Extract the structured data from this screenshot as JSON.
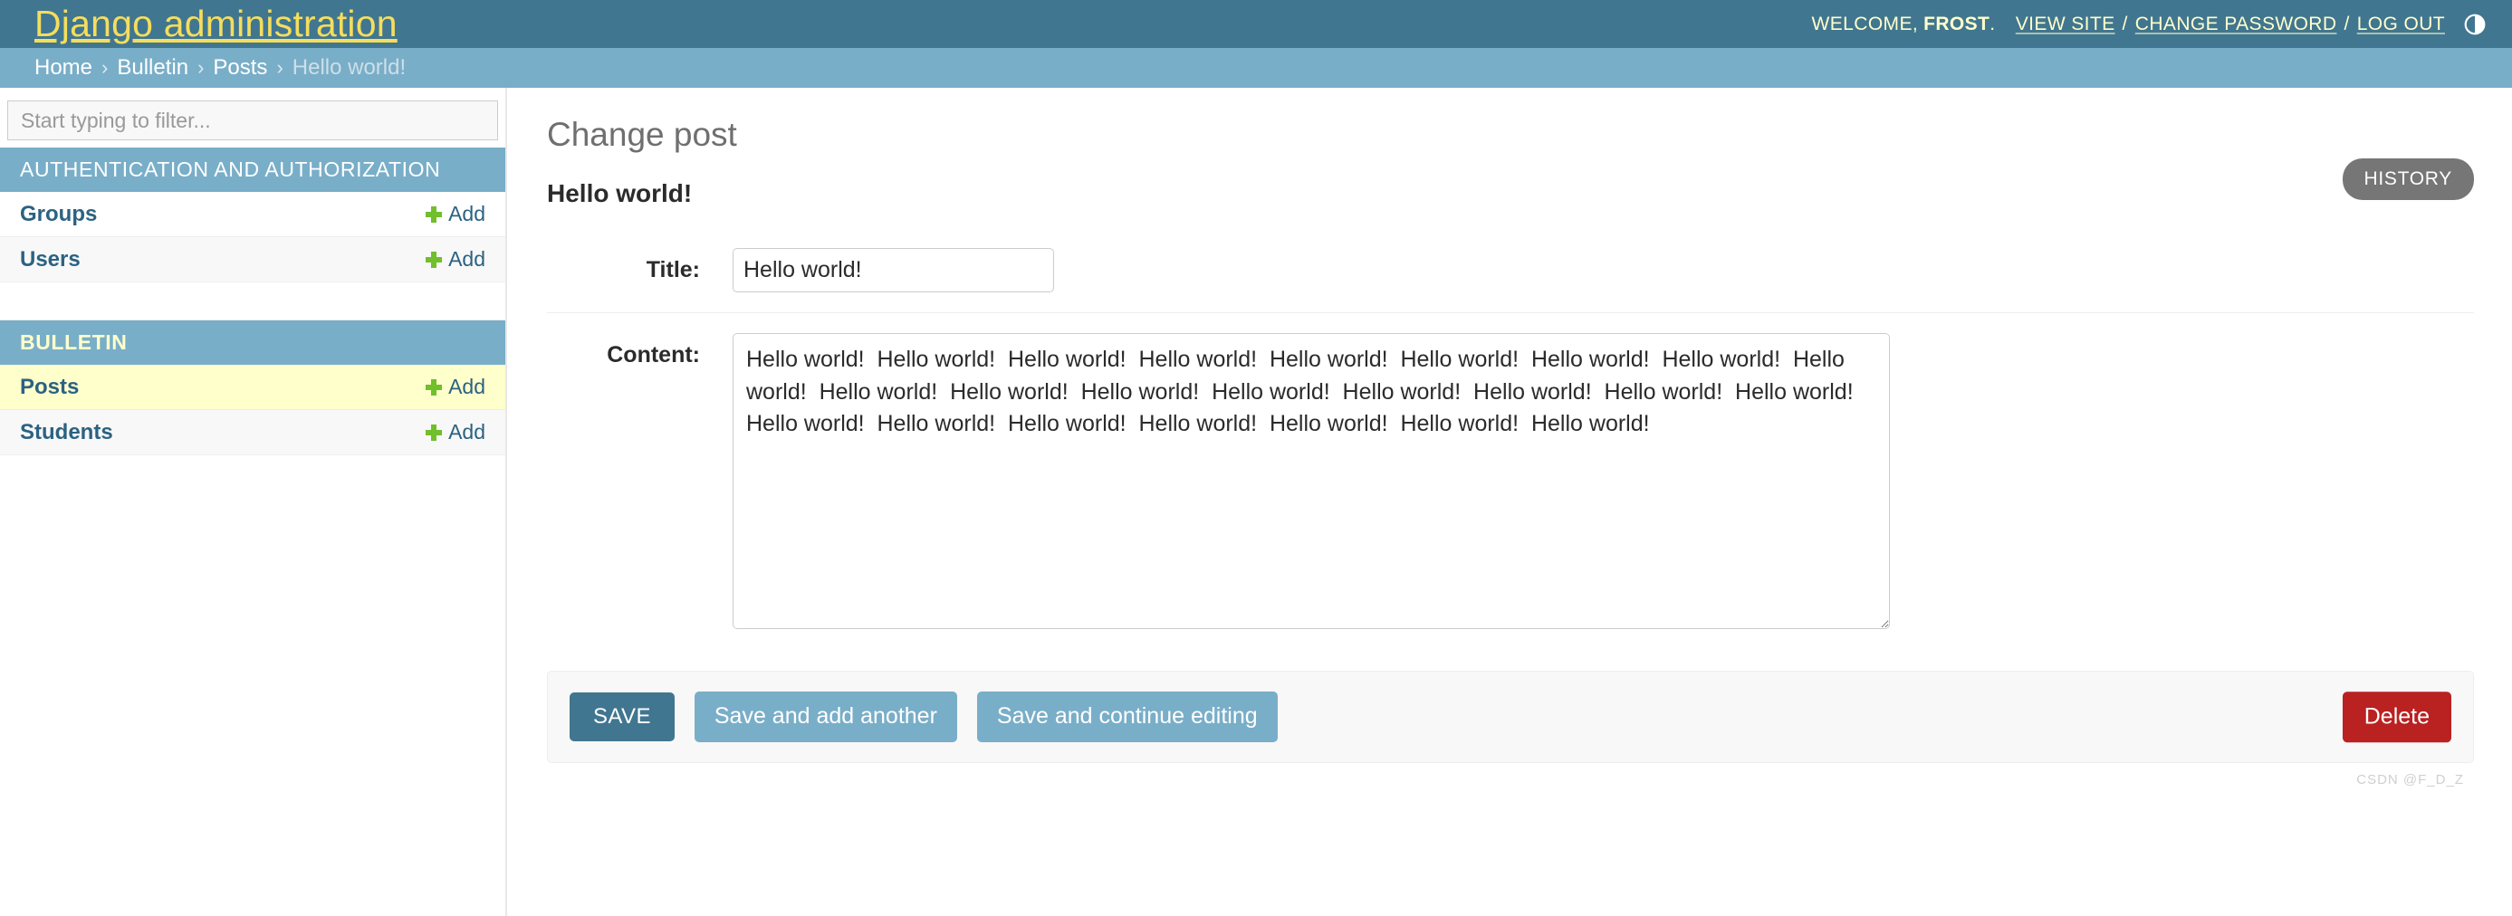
{
  "header": {
    "branding_title": "Django administration",
    "welcome_text": "WELCOME,",
    "username": "FROST",
    "period": ".",
    "view_site_label": "VIEW SITE",
    "change_password_label": "CHANGE PASSWORD",
    "log_out_label": "LOG OUT",
    "separator": "/",
    "theme_toggle_icon": "theme-half-circle-icon",
    "bg_color": "#417690",
    "title_color": "#f5dd5d"
  },
  "breadcrumbs": {
    "separator": "›",
    "items": [
      {
        "label": "Home",
        "current": false
      },
      {
        "label": "Bulletin",
        "current": false
      },
      {
        "label": "Posts",
        "current": false
      },
      {
        "label": "Hello world!",
        "current": true
      }
    ],
    "bg_color": "#79aec8"
  },
  "sidebar": {
    "filter": {
      "placeholder": "Start typing to filter...",
      "value": ""
    },
    "apps": [
      {
        "caption": "AUTHENTICATION AND AUTHORIZATION",
        "accent": false,
        "models": [
          {
            "name": "Groups",
            "add_label": "Add",
            "current": false
          },
          {
            "name": "Users",
            "add_label": "Add",
            "current": false
          }
        ]
      },
      {
        "caption": "BULLETIN",
        "accent": true,
        "models": [
          {
            "name": "Posts",
            "add_label": "Add",
            "current": true
          },
          {
            "name": "Students",
            "add_label": "Add",
            "current": false
          }
        ]
      }
    ],
    "add_icon": "plus-icon",
    "section_bg": "#79aec8",
    "current_row_bg": "#ffffcc"
  },
  "main": {
    "content_title": "Change post",
    "object_title": "Hello world!",
    "history_label": "HISTORY",
    "history_bg": "#767676"
  },
  "form": {
    "title_field": {
      "label": "Title:",
      "value": "Hello world!"
    },
    "content_field": {
      "label": "Content:",
      "value": "Hello world!  Hello world!  Hello world!  Hello world!  Hello world!  Hello world!  Hello world!  Hello world!  Hello world!  Hello world!  Hello world!  Hello world!  Hello world!  Hello world!  Hello world!  Hello world!  Hello world!  Hello world!  Hello world!  Hello world!  Hello world!  Hello world!  Hello world!  Hello world!"
    }
  },
  "submit_row": {
    "save_label": "SAVE",
    "save_add_another_label": "Save and add another",
    "save_continue_label": "Save and continue editing",
    "delete_label": "Delete",
    "save_bg": "#417690",
    "light_bg": "#79aec8",
    "delete_bg": "#ba2121"
  },
  "watermark": {
    "text": "CSDN @F_D_Z"
  }
}
